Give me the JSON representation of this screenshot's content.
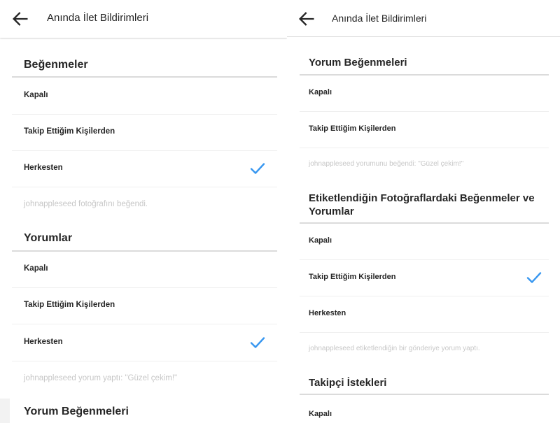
{
  "left": {
    "header_title": "Anında İlet Bildirimleri",
    "sections": [
      {
        "title": "Beğenmeler",
        "options": [
          "Kapalı",
          "Takip Ettiğim Kişilerden",
          "Herkesten"
        ],
        "selected": "Herkesten",
        "example": "johnappleseed fotoğrafını beğendi."
      },
      {
        "title": "Yorumlar",
        "options": [
          "Kapalı",
          "Takip Ettiğim Kişilerden",
          "Herkesten"
        ],
        "selected": "Herkesten",
        "example": "johnappleseed yorum yaptı: \"Güzel çekim!\""
      },
      {
        "title": "Yorum Beğenmeleri"
      }
    ]
  },
  "right": {
    "header_title": "Anında İlet Bildirimleri",
    "sections": [
      {
        "title": "Yorum Beğenmeleri",
        "options": [
          "Kapalı",
          "Takip Ettiğim Kişilerden"
        ],
        "example": "johnappleseed yorumunu beğendi: \"Güzel çekim!\""
      },
      {
        "title": "Etiketlendiğin Fotoğraflardaki Beğenmeler ve Yorumlar",
        "options": [
          "Kapalı",
          "Takip Ettiğim Kişilerden",
          "Herkesten"
        ],
        "selected": "Takip Ettiğim Kişilerden",
        "example": "johnappleseed etiketlendiğin bir gönderiye yorum yaptı."
      },
      {
        "title": "Takipçi İstekleri",
        "options": [
          "Kapalı"
        ]
      }
    ]
  },
  "icons": {
    "back": "arrow-left-icon",
    "selected": "checkmark-icon"
  },
  "colors": {
    "check": "#3897f0",
    "text": "#262626",
    "muted": "#c7c7c7",
    "divider": "#dbdbdb"
  }
}
